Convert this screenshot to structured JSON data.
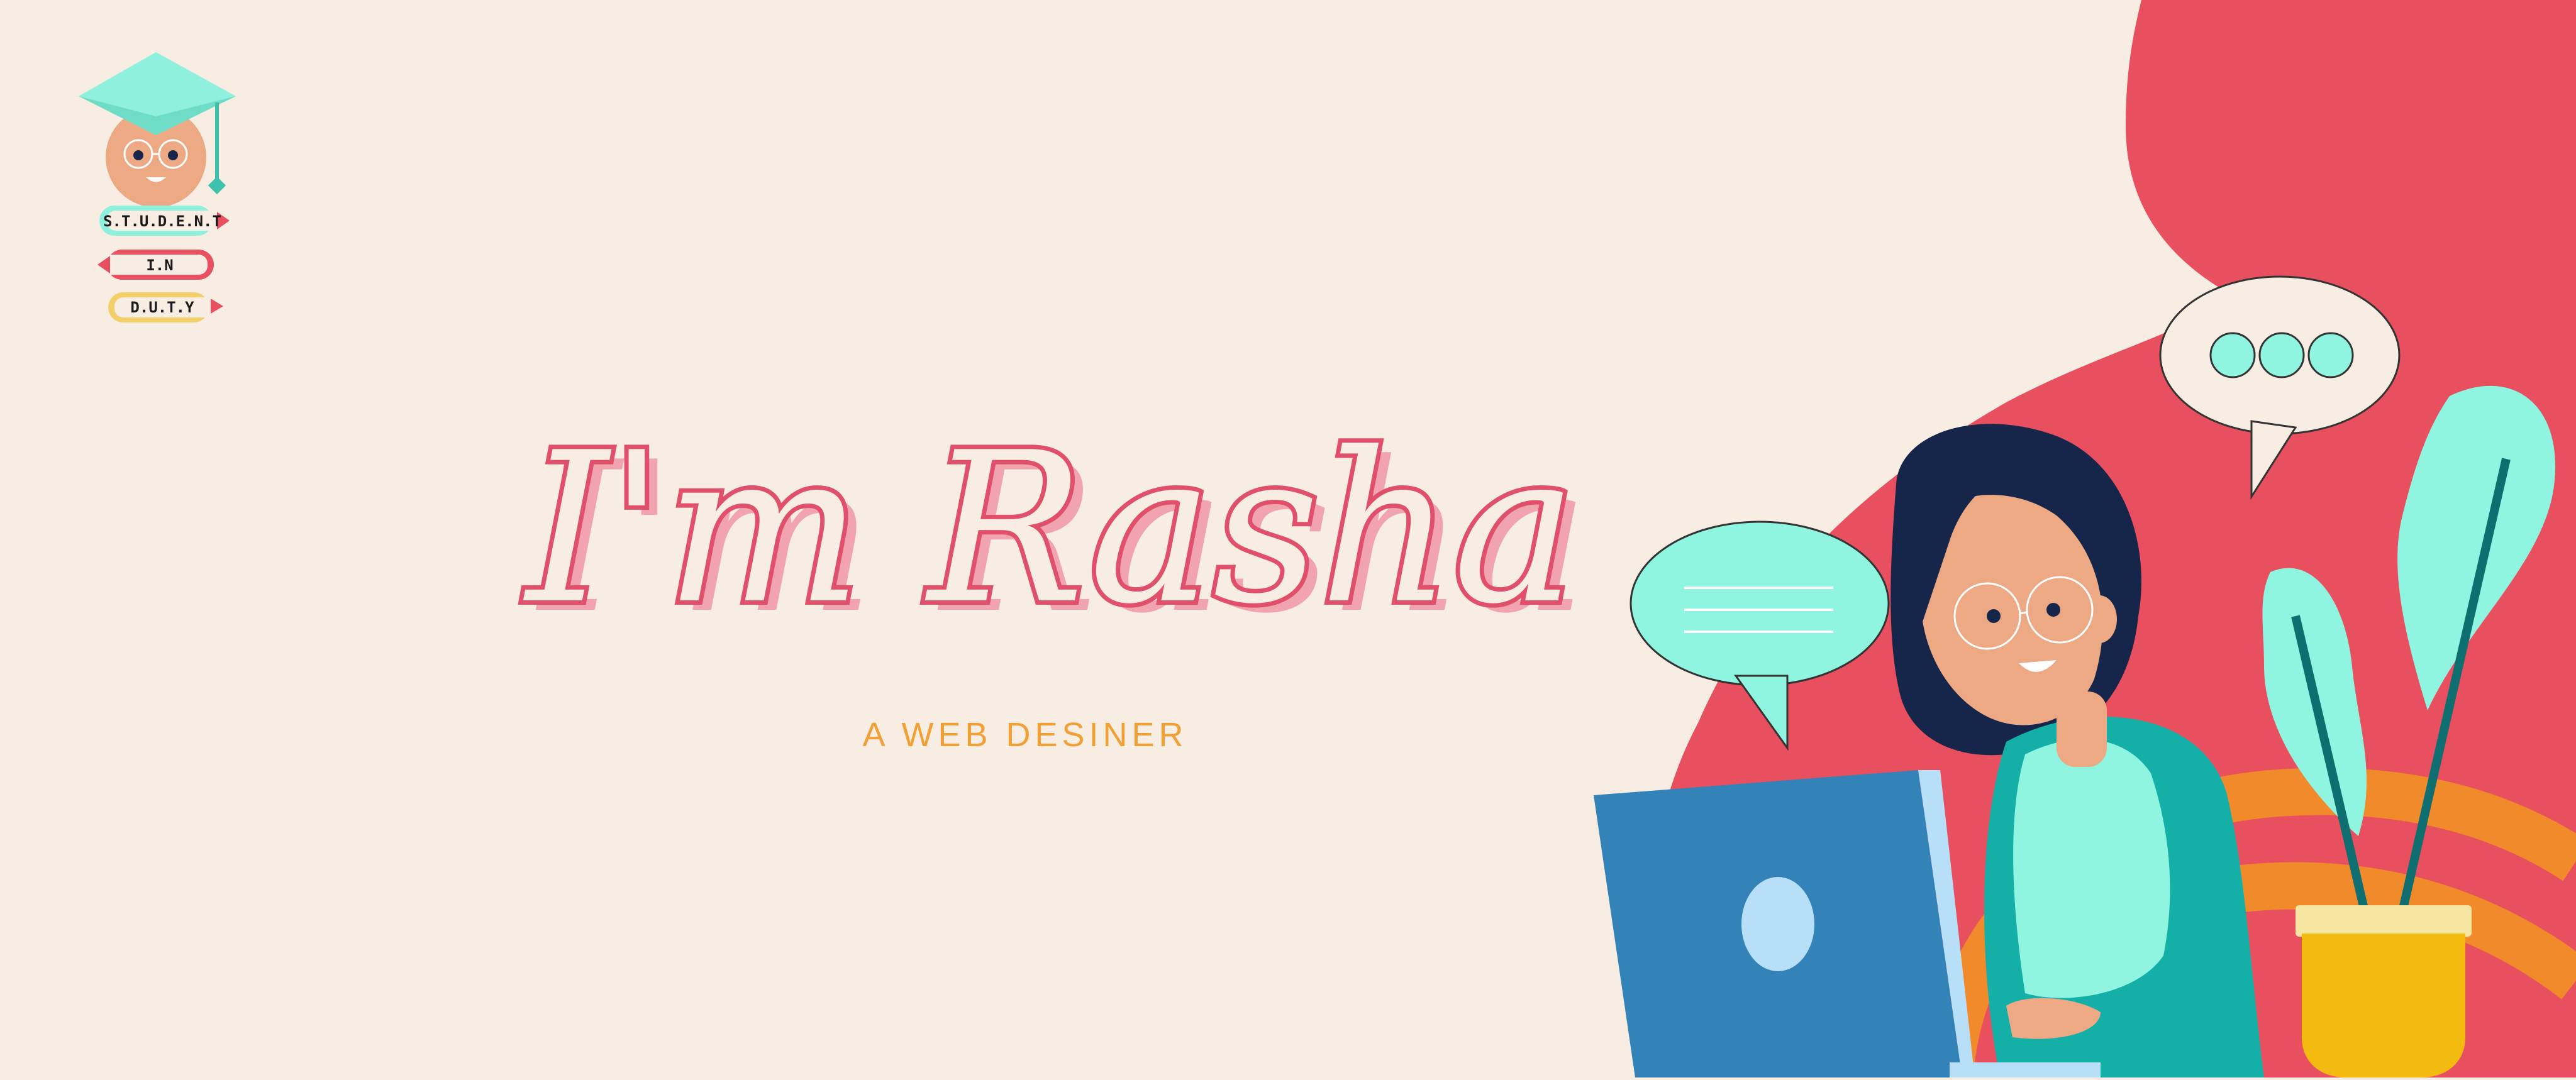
{
  "logo": {
    "line1": "S.T.U.D.E.N.T",
    "line2": "I.N",
    "line3": "D.U.T.Y"
  },
  "hero": {
    "headline": "I'm Rasha",
    "subtitle": "A WEB DESINER"
  },
  "colors": {
    "background": "#f8ede3",
    "accent_pink": "#e8505f",
    "accent_mint": "#8ff5e0",
    "accent_orange": "#f08a2a",
    "accent_navy": "#16264a",
    "subtitle_orange": "#f0a035"
  }
}
